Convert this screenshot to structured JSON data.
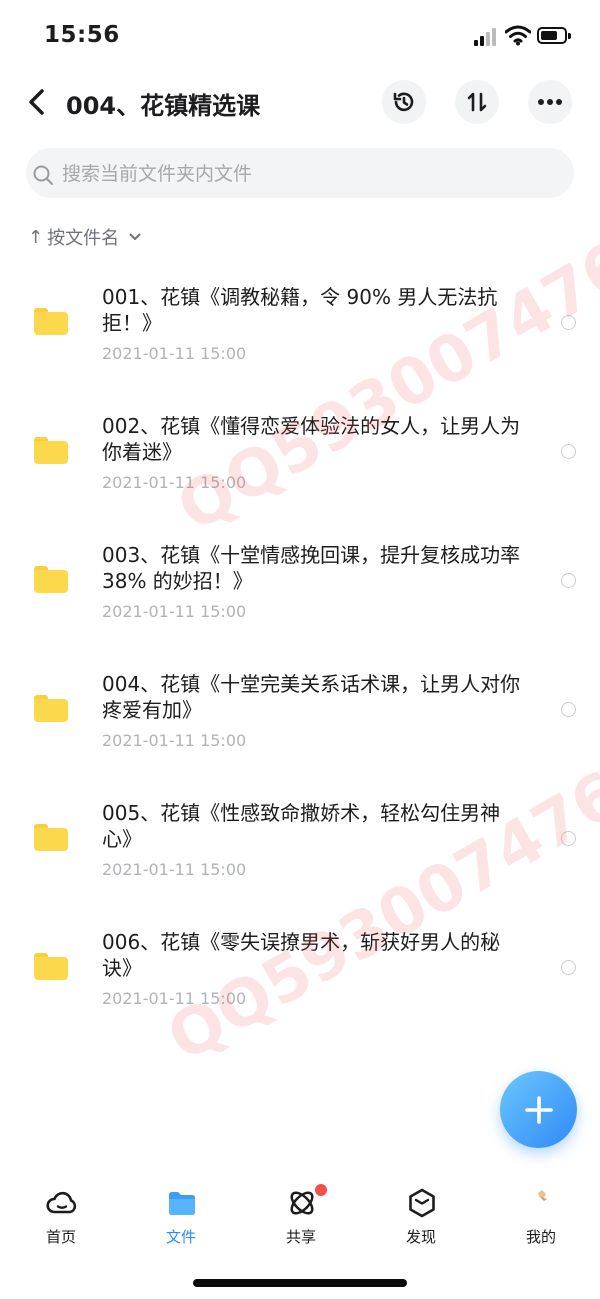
{
  "status_bar": {
    "time": "15:56"
  },
  "header": {
    "title": "004、花镇精选课"
  },
  "search": {
    "placeholder": "搜索当前文件夹内文件"
  },
  "sort": {
    "label": "按文件名"
  },
  "files": [
    {
      "name": "001、花镇《调教秘籍，令 90% 男人无法抗拒！》",
      "date": "2021-01-11 15:00"
    },
    {
      "name": "002、花镇《懂得恋爱体验法的女人，让男人为你着迷》",
      "date": "2021-01-11 15:00"
    },
    {
      "name": "003、花镇《十堂情感挽回课，提升复核成功率 38% 的妙招！》",
      "date": "2021-01-11 15:00"
    },
    {
      "name": "004、花镇《十堂完美关系话术课，让男人对你疼爱有加》",
      "date": "2021-01-11 15:00"
    },
    {
      "name": "005、花镇《性感致命撒娇术，轻松勾住男神心》",
      "date": "2021-01-11 15:00"
    },
    {
      "name": "006、花镇《零失误撩男术，斩获好男人的秘诀》",
      "date": "2021-01-11 15:00"
    }
  ],
  "watermark": {
    "text": "QQ593007476"
  },
  "tabs": [
    {
      "label": "首页",
      "icon": "cloud-icon"
    },
    {
      "label": "文件",
      "icon": "folder-icon"
    },
    {
      "label": "共享",
      "icon": "atom-icon"
    },
    {
      "label": "发现",
      "icon": "hexagon-icon"
    },
    {
      "label": "我的",
      "icon": "avatar-icon"
    }
  ],
  "colors": {
    "accent": "#2f8bf5",
    "folder": "#fbd84c",
    "badge": "#f2504b"
  }
}
